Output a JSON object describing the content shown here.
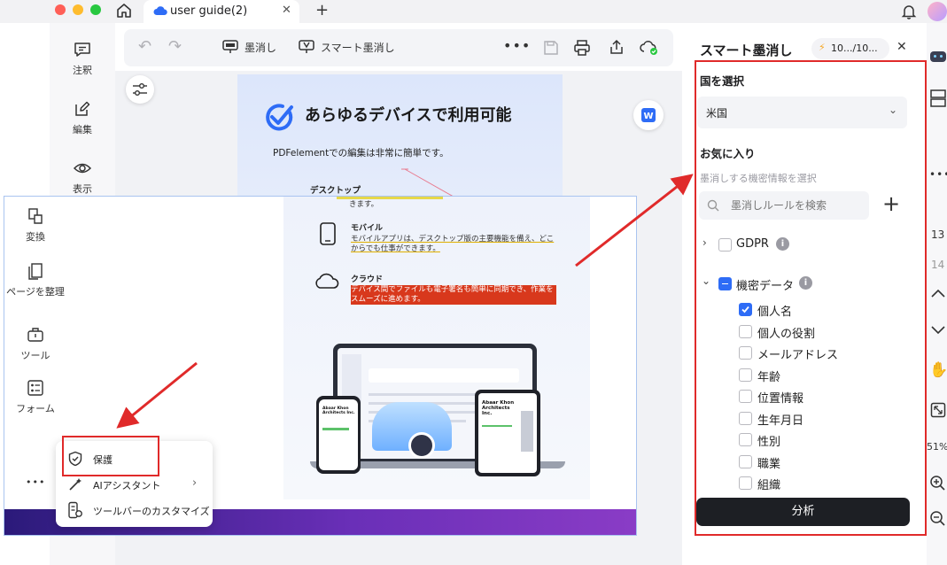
{
  "tab": {
    "title": "user guide(2)"
  },
  "leftnav": [
    {
      "id": "comment",
      "label": "注釈",
      "icon": "comment-icon"
    },
    {
      "id": "edit",
      "label": "編集",
      "icon": "edit-icon"
    },
    {
      "id": "view",
      "label": "表示",
      "icon": "eye-icon"
    }
  ],
  "toolbar": {
    "redact_label": "墨消し",
    "smart_redact_label": "スマート墨消し"
  },
  "document": {
    "heading": "あらゆるデバイスで利用可能",
    "subtitle": "PDFelementでの編集は非常に簡単です。",
    "desktop_title": "デスクトップ",
    "desktop_text": "きます。",
    "mobile_title": "モバイル",
    "mobile_text": "モバイルアプリは、デスクトップ版の主要機能を備え、どこからでも仕事ができます。",
    "cloud_title": "クラウド",
    "cloud_text": "デバイス間でファイルも電子署名も簡単に同期でき、作業をスムーズに進めます。",
    "tablet_title": "Abaar Khon Architects Inc.",
    "phone_title": "Abaar Khon Architects Inc."
  },
  "overlay_nav": [
    {
      "id": "convert",
      "label": "変換",
      "icon": "convert-icon"
    },
    {
      "id": "organize",
      "label": "ページを整理",
      "icon": "organize-icon"
    },
    {
      "id": "tools",
      "label": "ツール",
      "icon": "toolbox-icon"
    },
    {
      "id": "form",
      "label": "フォーム",
      "icon": "form-icon"
    }
  ],
  "overlay_menu": [
    {
      "label": "保護",
      "icon": "shield-icon"
    },
    {
      "label": "AIアシスタント",
      "icon": "ai-wand-icon"
    },
    {
      "label": "ツールバーのカスタマイズ",
      "icon": "customize-toolbar-icon"
    }
  ],
  "panel": {
    "title": "スマート墨消し",
    "badge": "10.../10...",
    "country_label": "国を選択",
    "country_value": "米国",
    "favorites_label": "お気に入り",
    "hint": "墨消しする機密情報を選択",
    "search_placeholder": "墨消しルールを検索",
    "groups": [
      {
        "label": "GDPR",
        "expanded": false,
        "checked": false
      },
      {
        "label": "機密データ",
        "expanded": true,
        "checked": "partial"
      }
    ],
    "items": [
      {
        "label": "個人名",
        "checked": true
      },
      {
        "label": "個人の役割",
        "checked": false
      },
      {
        "label": "メールアドレス",
        "checked": false
      },
      {
        "label": "年齢",
        "checked": false
      },
      {
        "label": "位置情報",
        "checked": false
      },
      {
        "label": "生年月日",
        "checked": false
      },
      {
        "label": "性別",
        "checked": false
      },
      {
        "label": "職業",
        "checked": false
      },
      {
        "label": "組織",
        "checked": false
      }
    ],
    "analyze_label": "分析"
  },
  "farright": {
    "page_current": "13",
    "page_next": "14",
    "zoom": "51%"
  },
  "colors": {
    "accent": "#2e6cf6",
    "annotation_red": "#e02a2a",
    "traffic_red": "#ff5f57",
    "traffic_yellow": "#febc2e",
    "traffic_green": "#28c840"
  }
}
